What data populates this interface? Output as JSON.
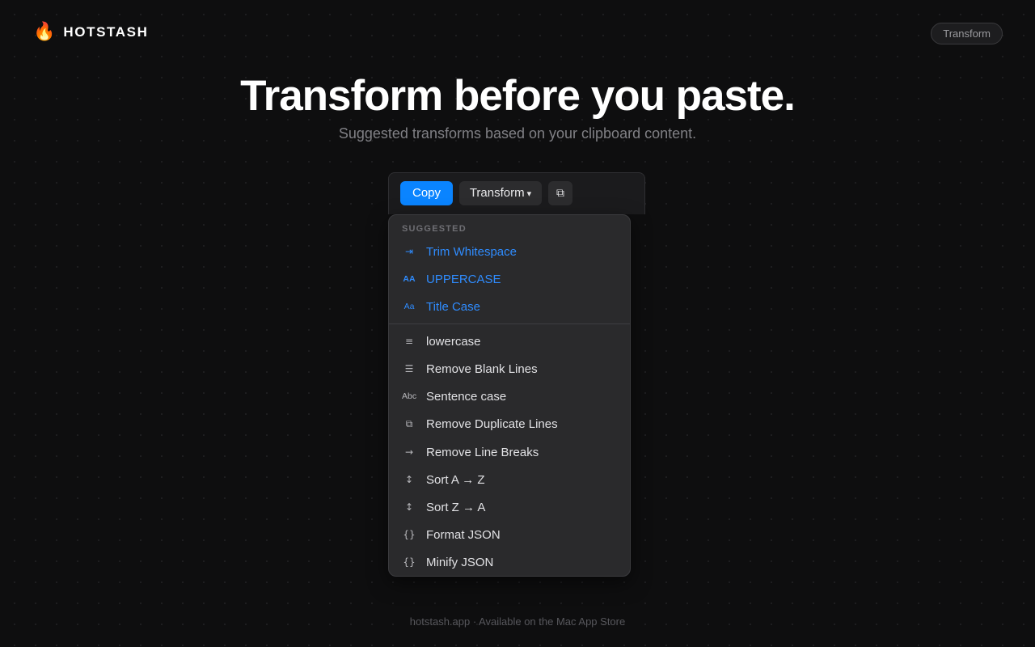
{
  "brand": {
    "name": "HOTSTASH",
    "icon": "flame-icon",
    "icon_glyph": "🔥"
  },
  "nav": {
    "pill_label": "Transform"
  },
  "hero": {
    "headline": "Transform before you paste.",
    "subheadline": "Suggested transforms based on your clipboard content."
  },
  "toolbar": {
    "copy_label": "Copy",
    "transform_label": "Transform",
    "transform_caret": "▾",
    "duplicate_icon": "duplicate-icon",
    "duplicate_glyph": "⧉"
  },
  "dropdown": {
    "section_label": "SUGGESTED",
    "suggested": [
      {
        "label": "Trim Whitespace",
        "icon": "trim-icon",
        "glyph": "⇥"
      },
      {
        "label": "UPPERCASE",
        "icon": "uppercase-icon",
        "glyph": "AA"
      },
      {
        "label": "Title Case",
        "icon": "title-case-icon",
        "glyph": "Aa"
      }
    ],
    "items": [
      {
        "label": "lowercase",
        "icon": "lowercase-icon",
        "glyph": "≡"
      },
      {
        "label": "Remove Blank Lines",
        "icon": "lines-icon",
        "glyph": "☰"
      },
      {
        "label": "Sentence case",
        "icon": "sentence-case-icon",
        "glyph": "Abc"
      },
      {
        "label": "Remove Duplicate Lines",
        "icon": "duplicate-icon",
        "glyph": "⧉"
      },
      {
        "label": "Remove Line Breaks",
        "icon": "arrow-right-icon",
        "glyph": "→"
      },
      {
        "label": "Sort A → Z",
        "icon": "sort-icon",
        "glyph": "↕"
      },
      {
        "label": "Sort Z → A",
        "icon": "sort-icon",
        "glyph": "↕"
      },
      {
        "label": "Format JSON",
        "icon": "braces-icon",
        "glyph": "{}"
      },
      {
        "label": "Minify JSON",
        "icon": "braces-icon",
        "glyph": "{}"
      }
    ]
  },
  "footer": {
    "text": "hotstash.app · Available on the Mac App Store"
  },
  "colors": {
    "accent": "#0a84ff",
    "suggested_text": "#2f8cff",
    "background": "#0e0e0f",
    "brand_flame": "#ff7a1a"
  }
}
